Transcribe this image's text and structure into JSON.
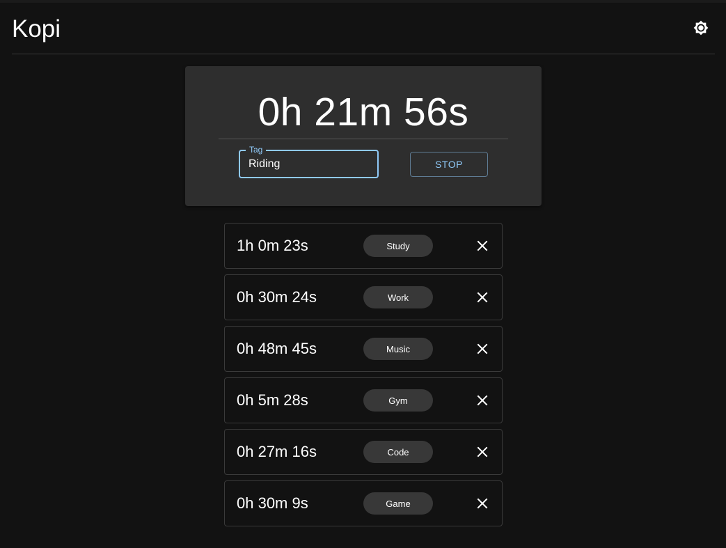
{
  "app": {
    "title": "Kopi",
    "settings_icon": "brightness-settings-icon"
  },
  "timer": {
    "display": "0h 21m 56s",
    "tag_field": {
      "label": "Tag",
      "value": "Riding"
    },
    "stop_label": "STOP"
  },
  "entries": [
    {
      "duration": "1h 0m 23s",
      "tag": "Study"
    },
    {
      "duration": "0h 30m 24s",
      "tag": "Work"
    },
    {
      "duration": "0h 48m 45s",
      "tag": "Music"
    },
    {
      "duration": "0h 5m 28s",
      "tag": "Gym"
    },
    {
      "duration": "0h 27m 16s",
      "tag": "Code"
    },
    {
      "duration": "0h 30m 9s",
      "tag": "Game"
    }
  ],
  "colors": {
    "background": "#121212",
    "card": "#2e2e2e",
    "accent": "#90caf9",
    "chip": "#383838",
    "text": "#ffffff"
  }
}
